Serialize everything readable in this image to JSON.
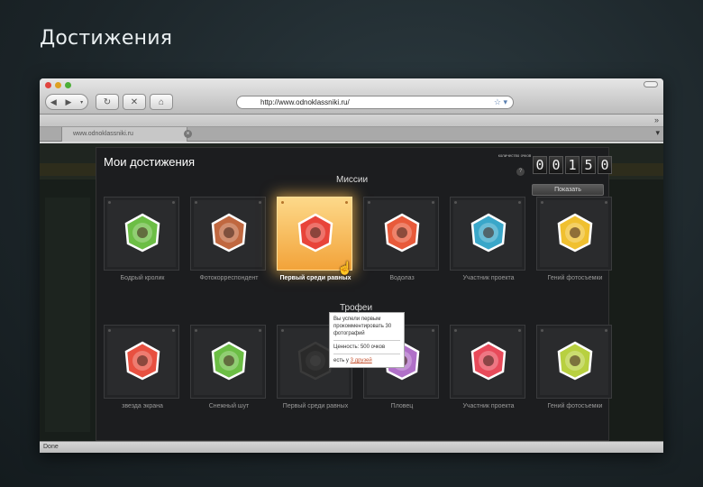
{
  "slide": {
    "title": "Достижения"
  },
  "browser": {
    "url": "http://www.odnoklassniki.ru/",
    "tab_title": "www.odnoklassniki.ru",
    "status": "Done"
  },
  "modal": {
    "title": "Мои достижения",
    "counter_label": "количество очков",
    "counter_digits": [
      "0",
      "0",
      "1",
      "5",
      "0"
    ],
    "show_button": "Показать",
    "sections": {
      "missions": "Миссии",
      "trophies": "Трофеи"
    },
    "missions": [
      {
        "label": "Бодрый кролик",
        "icon": "bear-badge-icon",
        "color": "#6cbe45"
      },
      {
        "label": "Фотокорреспондент",
        "icon": "cupcake-badge-icon",
        "color": "#c06840"
      },
      {
        "label": "Первый среди равных",
        "icon": "cupcake-badge-icon",
        "color": "#e8443a",
        "active": true
      },
      {
        "label": "Водолаз",
        "icon": "apple-badge-icon",
        "color": "#e85a3a"
      },
      {
        "label": "Участник проекта",
        "icon": "bird-badge-icon",
        "color": "#3aa7c9"
      },
      {
        "label": "Гений фотосъемки",
        "icon": "dog-badge-icon",
        "color": "#f0c030"
      }
    ],
    "trophies": [
      {
        "label": "звезда экрана",
        "icon": "star-badge-icon",
        "color": "#e85040"
      },
      {
        "label": "Снежный шут",
        "icon": "camera-badge-icon",
        "color": "#6cbe45"
      },
      {
        "label": "Первый среди равных",
        "icon": "locked-badge-icon",
        "color": "#444"
      },
      {
        "label": "Пловец",
        "icon": "robot-badge-icon",
        "color": "#b070c8"
      },
      {
        "label": "Участник проекта",
        "icon": "podium-badge-icon",
        "color": "#e84a5a"
      },
      {
        "label": "Гений фотосъемки",
        "icon": "tent-badge-icon",
        "color": "#b8d040"
      }
    ],
    "tooltip": {
      "text": "Вы успели первым прокомментировать 30 фотографий",
      "value": "Ценность: 500 очков",
      "friends_prefix": "есть у",
      "friends_link": "3 друзей"
    }
  }
}
